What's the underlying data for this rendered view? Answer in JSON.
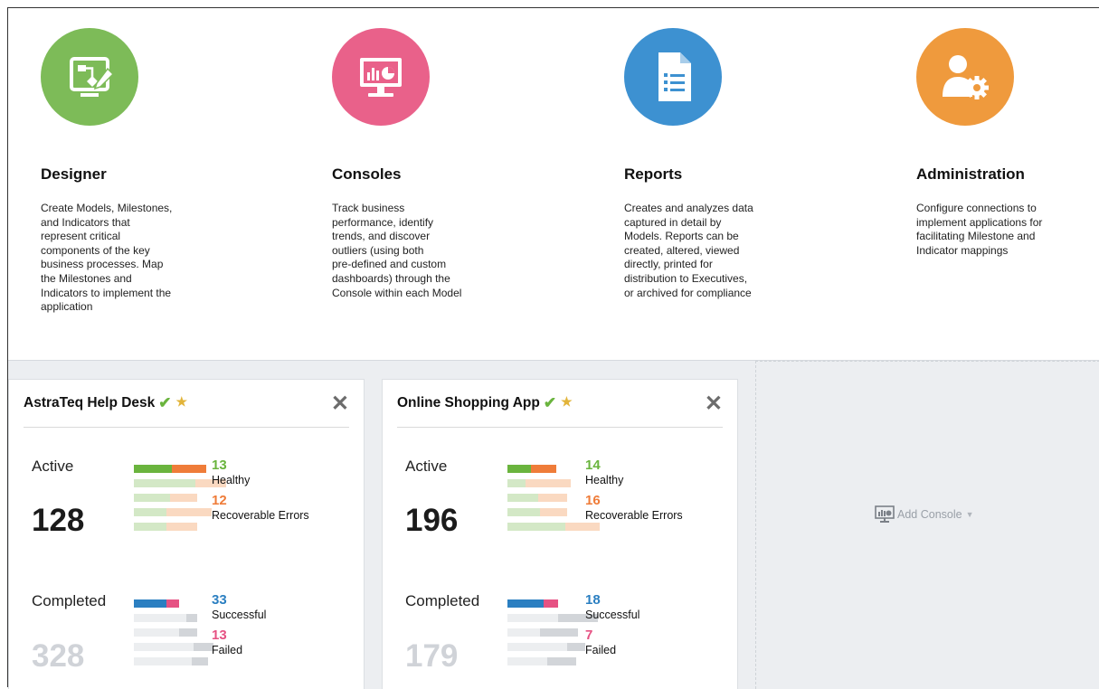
{
  "colors": {
    "designer": "#7dbb58",
    "consoles": "#e9618a",
    "reports": "#3d91d1",
    "administration": "#ef9a3d",
    "healthy": "#6ab43e",
    "recoverable": "#ef7c39",
    "successful": "#2b7fc1",
    "failed": "#e65283"
  },
  "tiles": [
    {
      "title": "Designer",
      "icon": "designer-icon",
      "desc": [
        "Create Models, Milestones,",
        "and Indicators that",
        "represent critical",
        "components of the key",
        "business processes. Map",
        "the Milestones and",
        "Indicators to implement the",
        "application"
      ]
    },
    {
      "title": "Consoles",
      "icon": "console-monitor-icon",
      "desc": [
        "Track business",
        "performance, identify",
        "trends, and discover",
        "outliers (using both",
        "pre-defined and custom",
        "dashboards) through the",
        "Console within each Model"
      ]
    },
    {
      "title": "Reports",
      "icon": "report-document-icon",
      "desc": [
        "Creates and analyzes data",
        "captured in detail by",
        "Models. Reports can be",
        "created, altered, viewed",
        "directly, printed for",
        "distribution to Executives,",
        "or archived for compliance"
      ]
    },
    {
      "title": "Administration",
      "icon": "admin-user-gear-icon",
      "desc": [
        "Configure connections to",
        "implement applications for",
        "facilitating Milestone and",
        "Indicator mappings"
      ]
    }
  ],
  "consoles": [
    {
      "title": "AstraTeq Help Desk",
      "active_label": "Active",
      "active_total": "128",
      "healthy_count": "13",
      "healthy_label": "Healthy",
      "recoverable_count": "12",
      "recoverable_label": "Recoverable Errors",
      "completed_label": "Completed",
      "completed_total": "328",
      "successful_count": "33",
      "successful_label": "Successful",
      "failed_count": "13",
      "failed_label": "Failed"
    },
    {
      "title": "Online Shopping App",
      "active_label": "Active",
      "active_total": "196",
      "healthy_count": "14",
      "healthy_label": "Healthy",
      "recoverable_count": "16",
      "recoverable_label": "Recoverable Errors",
      "completed_label": "Completed",
      "completed_total": "179",
      "successful_count": "18",
      "successful_label": "Successful",
      "failed_count": "7",
      "failed_label": "Failed"
    }
  ],
  "add_console": {
    "label": "Add Console",
    "icon": "console-monitor-icon"
  }
}
